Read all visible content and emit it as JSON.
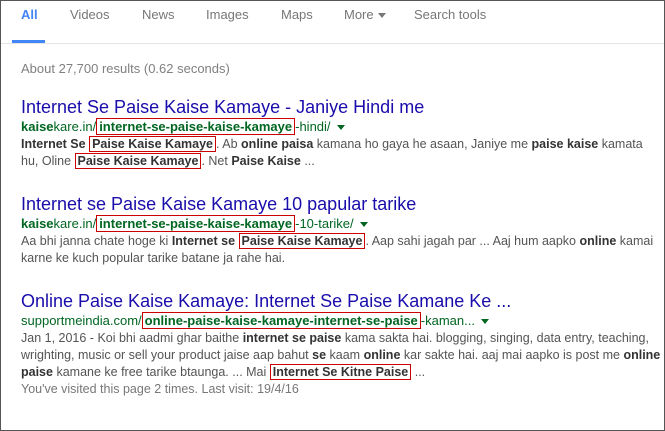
{
  "tabs": [
    {
      "label": "All"
    },
    {
      "label": "Videos"
    },
    {
      "label": "News"
    },
    {
      "label": "Images"
    },
    {
      "label": "Maps"
    },
    {
      "label": "More"
    },
    {
      "label": "Search tools"
    }
  ],
  "stats": "About 27,700 results (0.62 seconds)",
  "results": [
    {
      "title": "Internet Se Paise Kaise Kamaye - Janiye Hindi me",
      "url_bold": "kaise",
      "url_plain": "kare.in/",
      "url_boxed": "internet-se-paise-kaise-kamaye",
      "url_tail": "-hindi/",
      "snip": {
        "t1": "Internet Se",
        "b1": "Paise Kaise Kamaye",
        "t2": ". Ab",
        "b2": "online paisa",
        "t3": "kamana ho gaya he asaan, Janiye me",
        "b3": "paise kaise",
        "t4": "kamata hu, Oline",
        "b4": "Paise Kaise Kamaye",
        "t5": ". Net",
        "b5": "Paise Kaise",
        "t6": "..."
      }
    },
    {
      "title": "Internet se Paise Kaise Kamaye 10 papular tarike",
      "url_bold": "kaise",
      "url_plain": "kare.in/",
      "url_boxed": "internet-se-paise-kaise-kamaye",
      "url_tail": "-10-tarike/",
      "snip": {
        "t1": "Aa bhi janna chate hoge ki",
        "b1": "Internet se",
        "b2": "Paise Kaise Kamaye",
        "t2": ". Aap sahi jagah par ... Aaj hum aapko",
        "b3": "online",
        "t3": "kamai karne ke kuch popular tarike batane ja rahe hai."
      }
    },
    {
      "title": "Online Paise Kaise Kamaye: Internet Se Paise Kamane Ke ...",
      "url_plain": "supportmeindia.com/",
      "url_boxed": "online-paise-kaise-kamaye-internet-se-paise",
      "url_tail": "-kaman...",
      "snip": {
        "t1": "Jan 1, 2016 - Koi bhi aadmi ghar baithe",
        "b1": "internet se paise",
        "t2": "kama sakta hai. blogging, singing, data entry, teaching, wrighting, music or sell your product jaise aap bahut",
        "b2": "se",
        "t3": "kaam",
        "b3": "online",
        "t4": "kar sakte hai. aaj mai aapko is post me",
        "b4": "online paise",
        "t5": "kamane ke free tarike btaunga. ... Mai",
        "b5": "Internet Se Kitne Paise",
        "t6": "..."
      },
      "visited": "You've visited this page 2 times. Last visit: 19/4/16"
    }
  ],
  "colors": {
    "link": "#1a0dab",
    "url": "#006621",
    "accent": "#4285f4",
    "highlight_box": "#cc0000"
  }
}
